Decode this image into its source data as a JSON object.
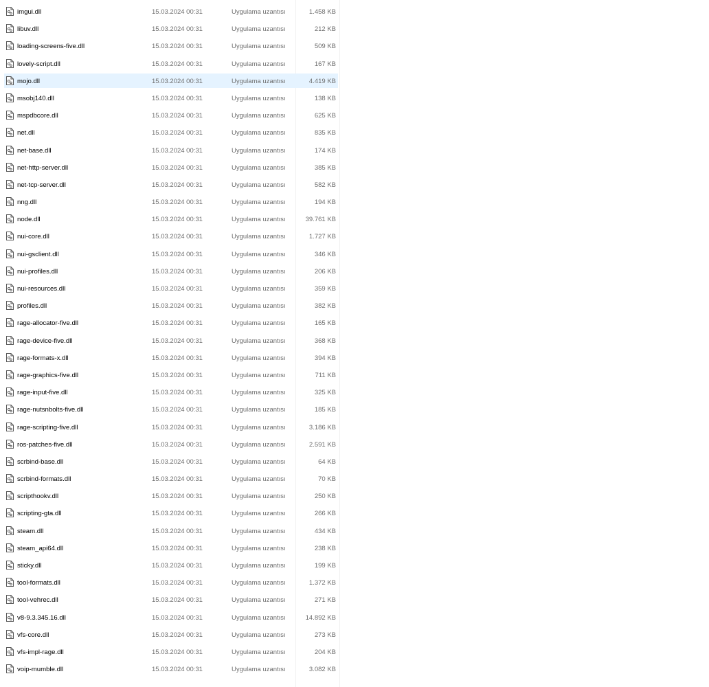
{
  "files": [
    {
      "name": "imgui.dll",
      "date": "15.03.2024 00:31",
      "type": "Uygulama uzantısı",
      "size": "1.458 KB"
    },
    {
      "name": "libuv.dll",
      "date": "15.03.2024 00:31",
      "type": "Uygulama uzantısı",
      "size": "212 KB"
    },
    {
      "name": "loading-screens-five.dll",
      "date": "15.03.2024 00:31",
      "type": "Uygulama uzantısı",
      "size": "509 KB"
    },
    {
      "name": "lovely-script.dll",
      "date": "15.03.2024 00:31",
      "type": "Uygulama uzantısı",
      "size": "167 KB"
    },
    {
      "name": "mojo.dll",
      "date": "15.03.2024 00:31",
      "type": "Uygulama uzantısı",
      "size": "4.419 KB",
      "selected": true
    },
    {
      "name": "msobj140.dll",
      "date": "15.03.2024 00:31",
      "type": "Uygulama uzantısı",
      "size": "138 KB"
    },
    {
      "name": "mspdbcore.dll",
      "date": "15.03.2024 00:31",
      "type": "Uygulama uzantısı",
      "size": "625 KB"
    },
    {
      "name": "net.dll",
      "date": "15.03.2024 00:31",
      "type": "Uygulama uzantısı",
      "size": "835 KB"
    },
    {
      "name": "net-base.dll",
      "date": "15.03.2024 00:31",
      "type": "Uygulama uzantısı",
      "size": "174 KB"
    },
    {
      "name": "net-http-server.dll",
      "date": "15.03.2024 00:31",
      "type": "Uygulama uzantısı",
      "size": "385 KB"
    },
    {
      "name": "net-tcp-server.dll",
      "date": "15.03.2024 00:31",
      "type": "Uygulama uzantısı",
      "size": "582 KB"
    },
    {
      "name": "nng.dll",
      "date": "15.03.2024 00:31",
      "type": "Uygulama uzantısı",
      "size": "194 KB"
    },
    {
      "name": "node.dll",
      "date": "15.03.2024 00:31",
      "type": "Uygulama uzantısı",
      "size": "39.761 KB"
    },
    {
      "name": "nui-core.dll",
      "date": "15.03.2024 00:31",
      "type": "Uygulama uzantısı",
      "size": "1.727 KB"
    },
    {
      "name": "nui-gsclient.dll",
      "date": "15.03.2024 00:31",
      "type": "Uygulama uzantısı",
      "size": "346 KB"
    },
    {
      "name": "nui-profiles.dll",
      "date": "15.03.2024 00:31",
      "type": "Uygulama uzantısı",
      "size": "206 KB"
    },
    {
      "name": "nui-resources.dll",
      "date": "15.03.2024 00:31",
      "type": "Uygulama uzantısı",
      "size": "359 KB"
    },
    {
      "name": "profiles.dll",
      "date": "15.03.2024 00:31",
      "type": "Uygulama uzantısı",
      "size": "382 KB"
    },
    {
      "name": "rage-allocator-five.dll",
      "date": "15.03.2024 00:31",
      "type": "Uygulama uzantısı",
      "size": "165 KB"
    },
    {
      "name": "rage-device-five.dll",
      "date": "15.03.2024 00:31",
      "type": "Uygulama uzantısı",
      "size": "368 KB"
    },
    {
      "name": "rage-formats-x.dll",
      "date": "15.03.2024 00:31",
      "type": "Uygulama uzantısı",
      "size": "394 KB"
    },
    {
      "name": "rage-graphics-five.dll",
      "date": "15.03.2024 00:31",
      "type": "Uygulama uzantısı",
      "size": "711 KB"
    },
    {
      "name": "rage-input-five.dll",
      "date": "15.03.2024 00:31",
      "type": "Uygulama uzantısı",
      "size": "325 KB"
    },
    {
      "name": "rage-nutsnbolts-five.dll",
      "date": "15.03.2024 00:31",
      "type": "Uygulama uzantısı",
      "size": "185 KB"
    },
    {
      "name": "rage-scripting-five.dll",
      "date": "15.03.2024 00:31",
      "type": "Uygulama uzantısı",
      "size": "3.186 KB"
    },
    {
      "name": "ros-patches-five.dll",
      "date": "15.03.2024 00:31",
      "type": "Uygulama uzantısı",
      "size": "2.591 KB"
    },
    {
      "name": "scrbind-base.dll",
      "date": "15.03.2024 00:31",
      "type": "Uygulama uzantısı",
      "size": "64 KB"
    },
    {
      "name": "scrbind-formats.dll",
      "date": "15.03.2024 00:31",
      "type": "Uygulama uzantısı",
      "size": "70 KB"
    },
    {
      "name": "scripthookv.dll",
      "date": "15.03.2024 00:31",
      "type": "Uygulama uzantısı",
      "size": "250 KB"
    },
    {
      "name": "scripting-gta.dll",
      "date": "15.03.2024 00:31",
      "type": "Uygulama uzantısı",
      "size": "266 KB"
    },
    {
      "name": "steam.dll",
      "date": "15.03.2024 00:31",
      "type": "Uygulama uzantısı",
      "size": "434 KB"
    },
    {
      "name": "steam_api64.dll",
      "date": "15.03.2024 00:31",
      "type": "Uygulama uzantısı",
      "size": "238 KB"
    },
    {
      "name": "sticky.dll",
      "date": "15.03.2024 00:31",
      "type": "Uygulama uzantısı",
      "size": "199 KB"
    },
    {
      "name": "tool-formats.dll",
      "date": "15.03.2024 00:31",
      "type": "Uygulama uzantısı",
      "size": "1.372 KB"
    },
    {
      "name": "tool-vehrec.dll",
      "date": "15.03.2024 00:31",
      "type": "Uygulama uzantısı",
      "size": "271 KB"
    },
    {
      "name": "v8-9.3.345.16.dll",
      "date": "15.03.2024 00:31",
      "type": "Uygulama uzantısı",
      "size": "14.892 KB"
    },
    {
      "name": "vfs-core.dll",
      "date": "15.03.2024 00:31",
      "type": "Uygulama uzantısı",
      "size": "273 KB"
    },
    {
      "name": "vfs-impl-rage.dll",
      "date": "15.03.2024 00:31",
      "type": "Uygulama uzantısı",
      "size": "204 KB"
    },
    {
      "name": "voip-mumble.dll",
      "date": "15.03.2024 00:31",
      "type": "Uygulama uzantısı",
      "size": "3.082 KB"
    }
  ],
  "icons": {
    "file": "dll-file-icon"
  },
  "colors": {
    "selection": "#e5f3ff",
    "secondary_text": "#6d6d6d"
  }
}
